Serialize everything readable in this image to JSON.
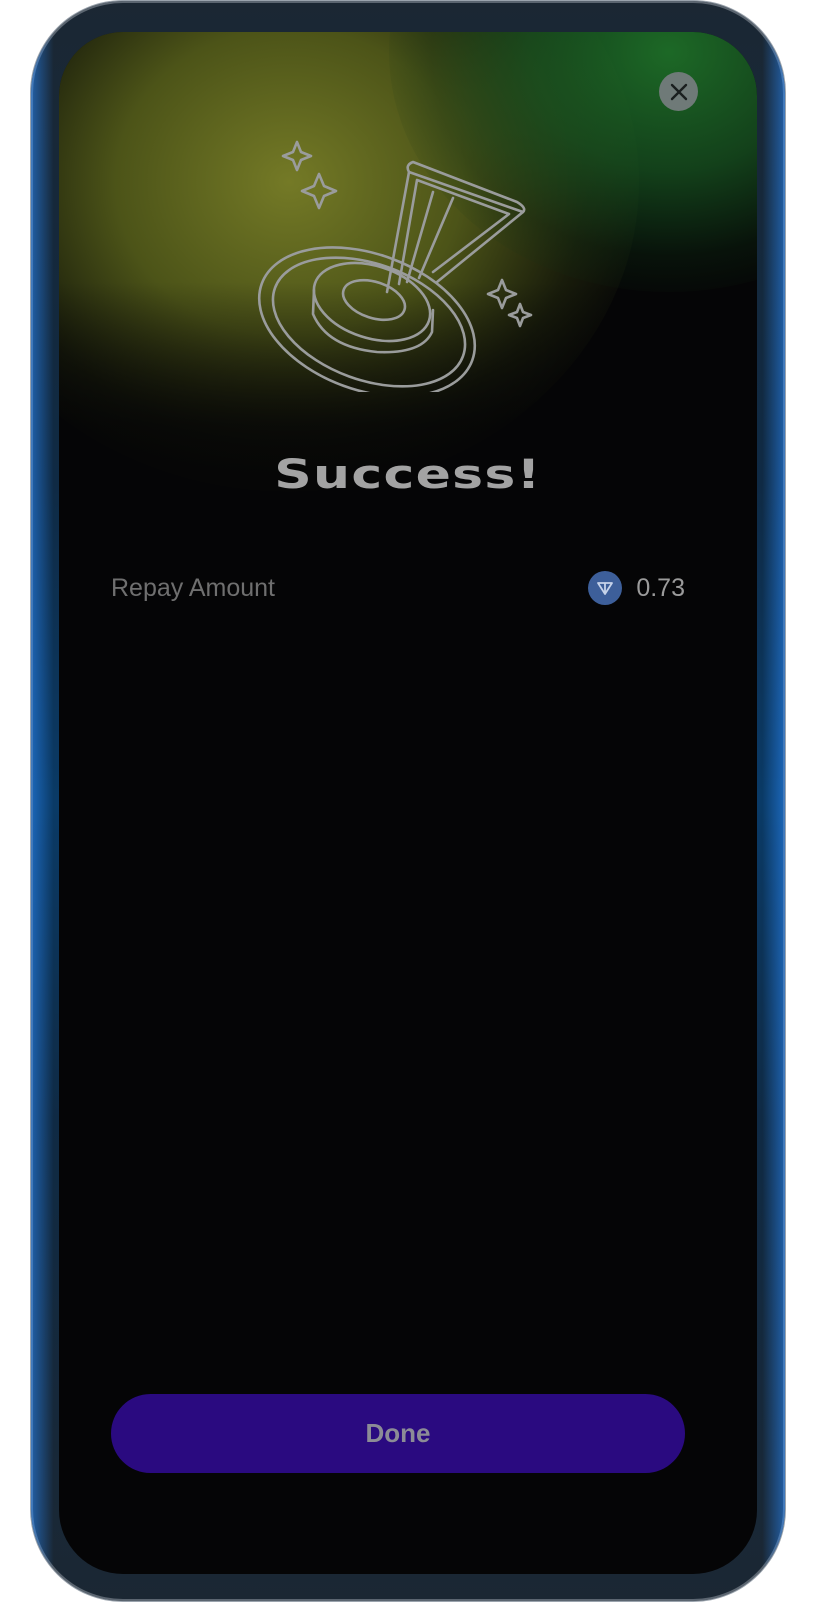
{
  "header": {
    "close_icon": "close-icon"
  },
  "hero": {
    "illustration_icon": "joystick-success-icon"
  },
  "main": {
    "title": "Success!",
    "details": [
      {
        "label": "Repay Amount",
        "value": "0.73",
        "token_icon": "ton-token-icon"
      }
    ]
  },
  "footer": {
    "done_label": "Done"
  },
  "colors": {
    "primary_button": "#2a0a80",
    "token_blue": "#3d5f9a",
    "glow_yellow": "#7a8028",
    "glow_green": "#1e6e28"
  }
}
